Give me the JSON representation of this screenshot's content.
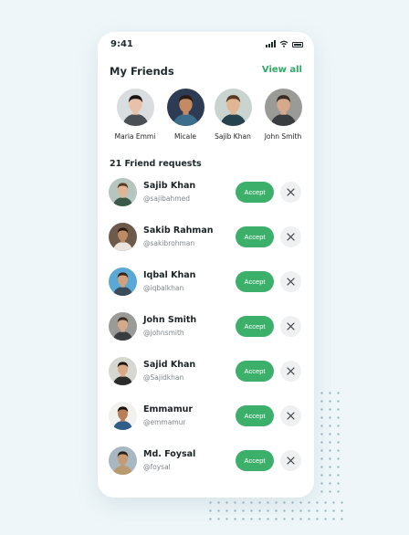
{
  "status_bar": {
    "time": "9:41"
  },
  "friends": {
    "title": "My Friends",
    "view_all_label": "View all",
    "items": [
      {
        "name": "Maria Emmi",
        "bg": "#d9dde0",
        "skin": "#e8c2a8",
        "hair": "#1b1414",
        "shirt": "#4a4f55"
      },
      {
        "name": "Micale",
        "bg": "#2d3b54",
        "skin": "#c48a63",
        "hair": "#2a1a12",
        "shirt": "#3c6e8c"
      },
      {
        "name": "Sajib Khan",
        "bg": "#c9d3cf",
        "skin": "#e0b594",
        "hair": "#5a3a22",
        "shirt": "#27424f"
      },
      {
        "name": "John Smith",
        "bg": "#9a9b97",
        "skin": "#d6a98a",
        "hair": "#3a2c22",
        "shirt": "#3a3d3f"
      }
    ]
  },
  "requests": {
    "title": "21 Friend requests",
    "accept_label": "Accept",
    "items": [
      {
        "name": "Sajib Khan",
        "handle": "@sajibahmed",
        "bg": "#b6c5bd",
        "skin": "#e0b594",
        "hair": "#5a3a22",
        "shirt": "#3b5a4a"
      },
      {
        "name": "Sakib Rahman",
        "handle": "@sakibrohman",
        "bg": "#6e5a4b",
        "skin": "#c08a66",
        "hair": "#2a1b12",
        "shirt": "#e9e4de"
      },
      {
        "name": "Iqbal Khan",
        "handle": "@iqbalkhan",
        "bg": "#5aa8d6",
        "skin": "#d4a07c",
        "hair": "#3a2418",
        "shirt": "#3a4b5a"
      },
      {
        "name": "John Smith",
        "handle": "@johnsmith",
        "bg": "#9a9b97",
        "skin": "#d6a98a",
        "hair": "#3a2c22",
        "shirt": "#3a3d3f"
      },
      {
        "name": "Sajid Khan",
        "handle": "@Sajidkhan",
        "bg": "#d7d7d2",
        "skin": "#d9a884",
        "hair": "#1f1611",
        "shirt": "#2b2b2b"
      },
      {
        "name": "Emmamur",
        "handle": "@emmamur",
        "bg": "#f1f1ee",
        "skin": "#b97e58",
        "hair": "#1a120d",
        "shirt": "#2f5d8a"
      },
      {
        "name": "Md. Foysal",
        "handle": "@foysal",
        "bg": "#a8b8c2",
        "skin": "#c89a74",
        "hair": "#2d2016",
        "shirt": "#b99a6e"
      }
    ]
  },
  "colors": {
    "accent": "#3caf6b",
    "link": "#2eaa63",
    "background": "#eef6f9"
  }
}
